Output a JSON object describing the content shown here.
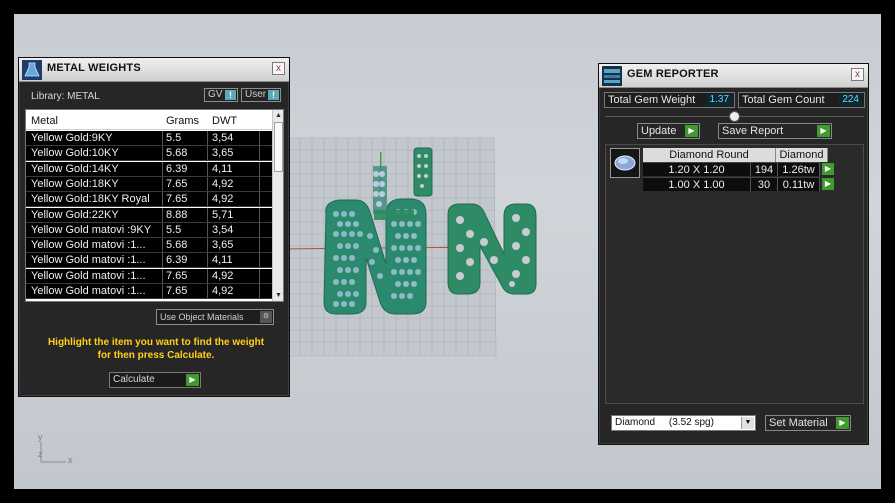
{
  "metal_panel": {
    "title": "METAL WEIGHTS",
    "close": "x",
    "library_label": "Library: METAL",
    "gv_toggle": "GV",
    "user_toggle": "User",
    "columns": [
      "Metal",
      "Grams",
      "DWT"
    ],
    "rows": [
      {
        "metal": "Yellow Gold:9KY",
        "grams": "5.5",
        "dwt": "3,54"
      },
      {
        "metal": "Yellow Gold:10KY",
        "grams": "5.68",
        "dwt": "3,65"
      },
      {
        "metal": "Yellow Gold:14KY",
        "grams": "6.39",
        "dwt": "4,11"
      },
      {
        "metal": "Yellow Gold:18KY",
        "grams": "7.65",
        "dwt": "4,92"
      },
      {
        "metal": "Yellow Gold:18KY Royal",
        "grams": "7.65",
        "dwt": "4,92"
      },
      {
        "metal": "Yellow Gold:22KY",
        "grams": "8.88",
        "dwt": "5,71"
      },
      {
        "metal": "Yellow Gold matovi :9KY",
        "grams": "5.5",
        "dwt": "3,54"
      },
      {
        "metal": "Yellow Gold matovi :1...",
        "grams": "5.68",
        "dwt": "3,65"
      },
      {
        "metal": "Yellow Gold matovi :1...",
        "grams": "6.39",
        "dwt": "4,11"
      },
      {
        "metal": "Yellow Gold matovi :1...",
        "grams": "7.65",
        "dwt": "4,92"
      },
      {
        "metal": "Yellow Gold matovi :1...",
        "grams": "7.65",
        "dwt": "4,92"
      }
    ],
    "use_object_materials": "Use Object Materials",
    "hint_line1": "Highlight the item you want to find the weight",
    "hint_line2": "for then press Calculate.",
    "calculate_label": "Calculate"
  },
  "gem_panel": {
    "title": "GEM REPORTER",
    "close": "x",
    "total_weight_label": "Total Gem Weight",
    "total_weight_value": "1.37",
    "total_count_label": "Total Gem Count",
    "total_count_value": "224",
    "update_label": "Update",
    "save_report_label": "Save Report",
    "gem_header_cut": "Diamond Round",
    "gem_header_material": "Diamond",
    "gem_rows": [
      {
        "size": "1.20 X 1.20",
        "count": "194",
        "weight": "1.26tw"
      },
      {
        "size": "1.00 X 1.00",
        "count": "30",
        "weight": "0.11tw"
      }
    ],
    "material_select": "Diamond     (3.52 spg)",
    "set_material_label": "Set Material"
  },
  "viewport": {
    "axis_y": "y",
    "axis_z": "z",
    "axis_x": "x"
  },
  "colors": {
    "panel_bg": "#262626",
    "hint_yellow": "#ffd11a",
    "go_green": "#3f9b2e",
    "model_green": "#2f8b66",
    "gem_blue": "#9fb3d0"
  }
}
